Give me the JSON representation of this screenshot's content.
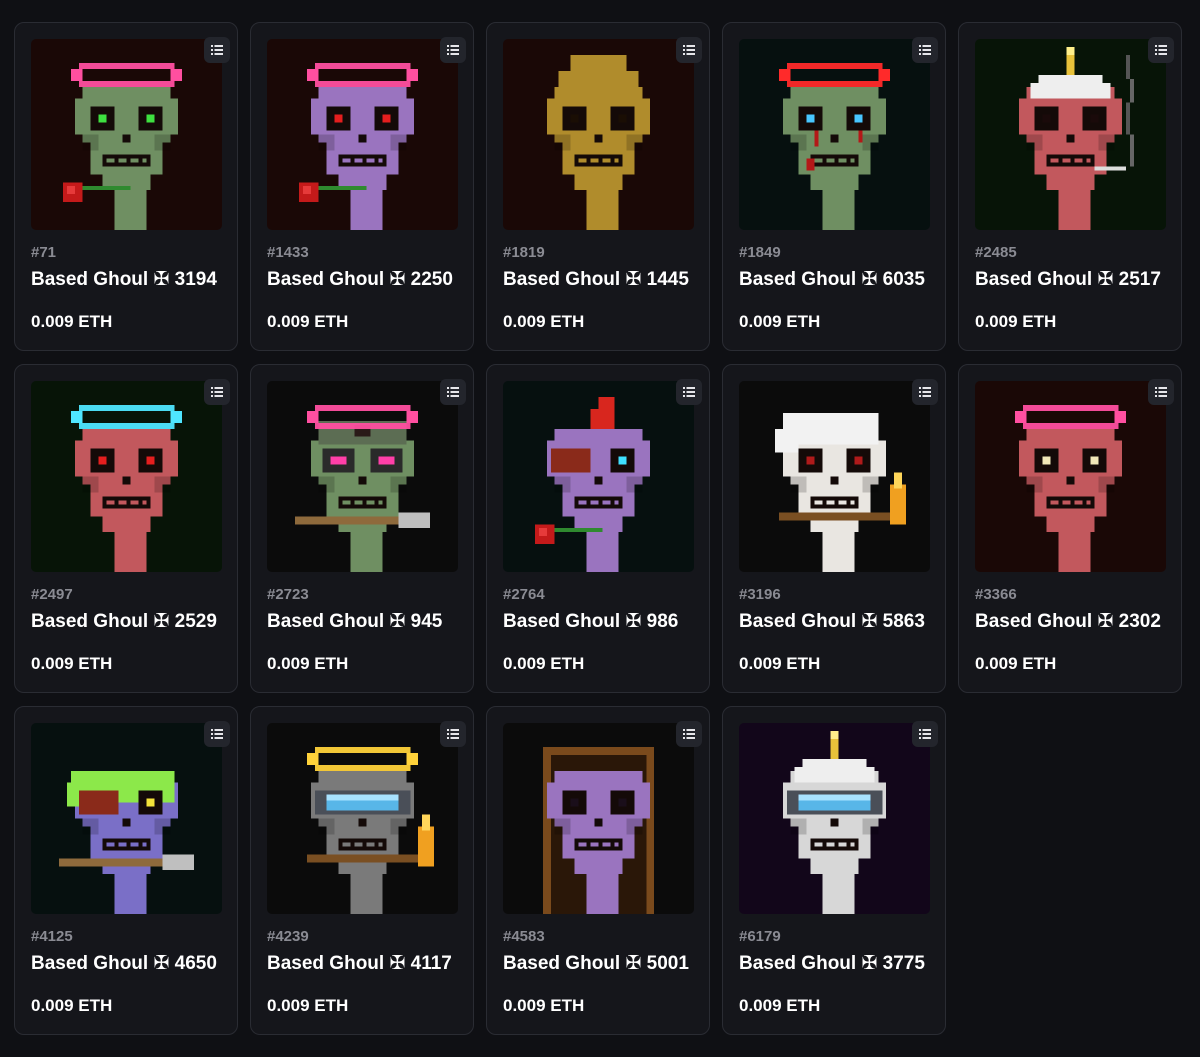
{
  "items": [
    {
      "id": "#71",
      "name": "Based Ghoul ✠ 3194",
      "price": "0.009 ETH",
      "bg": "#1a0806",
      "skull": "#6f8f62",
      "eyes": "#3ee040",
      "halo": "#ff4fa0",
      "hat": "",
      "accessory": "rose"
    },
    {
      "id": "#1433",
      "name": "Based Ghoul ✠ 2250",
      "price": "0.009 ETH",
      "bg": "#1a0806",
      "skull": "#9a74bf",
      "eyes": "#e51e1e",
      "halo": "#ff4fa0",
      "hat": "",
      "accessory": "rose"
    },
    {
      "id": "#1819",
      "name": "Based Ghoul ✠ 1445",
      "price": "0.009 ETH",
      "bg": "#1a0806",
      "skull": "#b08c2c",
      "eyes": "#1a0e04",
      "halo": "",
      "hat": "hood-gold",
      "accessory": ""
    },
    {
      "id": "#1849",
      "name": "Based Ghoul ✠ 6035",
      "price": "0.009 ETH",
      "bg": "#06100f",
      "skull": "#6f8f62",
      "eyes": "#48c6ff",
      "halo": "#ff2a2a",
      "hat": "",
      "accessory": "blood"
    },
    {
      "id": "#2485",
      "name": "Based Ghoul ✠ 2517",
      "price": "0.009 ETH",
      "bg": "#071407",
      "skull": "#c2585d",
      "eyes": "#1a0a0a",
      "halo": "",
      "hat": "candle",
      "accessory": "smoke"
    },
    {
      "id": "#2497",
      "name": "Based Ghoul ✠ 2529",
      "price": "0.009 ETH",
      "bg": "#071407",
      "skull": "#c2585d",
      "eyes": "#e51e1e",
      "halo": "#4fe6ff",
      "hat": "",
      "accessory": ""
    },
    {
      "id": "#2723",
      "name": "Based Ghoul ✠ 945",
      "price": "0.009 ETH",
      "bg": "#0b0b0b",
      "skull": "#6f8f62",
      "eyes": "#ff3fa8",
      "halo": "#ff4fa0",
      "hat": "helmet",
      "accessory": "sword"
    },
    {
      "id": "#2764",
      "name": "Based Ghoul ✠ 986",
      "price": "0.009 ETH",
      "bg": "#06100f",
      "skull": "#9a74bf",
      "eyes": "#3fe0ff",
      "halo": "",
      "hat": "mohawk",
      "accessory": "rose"
    },
    {
      "id": "#3196",
      "name": "Based Ghoul ✠ 5863",
      "price": "0.009 ETH",
      "bg": "#0b0b0b",
      "skull": "#e9e6e1",
      "eyes": "#b01a1a",
      "halo": "",
      "hat": "hair-white",
      "accessory": "torch"
    },
    {
      "id": "#3366",
      "name": "Based Ghoul ✠ 2302",
      "price": "0.009 ETH",
      "bg": "#1a0806",
      "skull": "#c2585d",
      "eyes": "#f1e8b8",
      "halo": "#ff4fa0",
      "hat": "",
      "accessory": ""
    },
    {
      "id": "#4125",
      "name": "Based Ghoul ✠ 4650",
      "price": "0.009 ETH",
      "bg": "#06100f",
      "skull": "#7a6fc7",
      "eyes": "#f3e33a",
      "halo": "",
      "hat": "hair-green",
      "accessory": "sword"
    },
    {
      "id": "#4239",
      "name": "Based Ghoul ✠ 4117",
      "price": "0.009 ETH",
      "bg": "#0b0b0b",
      "skull": "#7a7a7a",
      "eyes": "#49b8f0",
      "halo": "#ffd23a",
      "hat": "visor",
      "accessory": "torch"
    },
    {
      "id": "#4583",
      "name": "Based Ghoul ✠ 5001",
      "price": "0.009 ETH",
      "bg": "#0b0b0b",
      "skull": "#9a74bf",
      "eyes": "#1a0e1a",
      "halo": "",
      "hat": "hood-brown",
      "accessory": ""
    },
    {
      "id": "#6179",
      "name": "Based Ghoul ✠ 3775",
      "price": "0.009 ETH",
      "bg": "#12061a",
      "skull": "#d7d7d7",
      "eyes": "#3f6cff",
      "halo": "",
      "hat": "candle-visor",
      "accessory": ""
    }
  ]
}
